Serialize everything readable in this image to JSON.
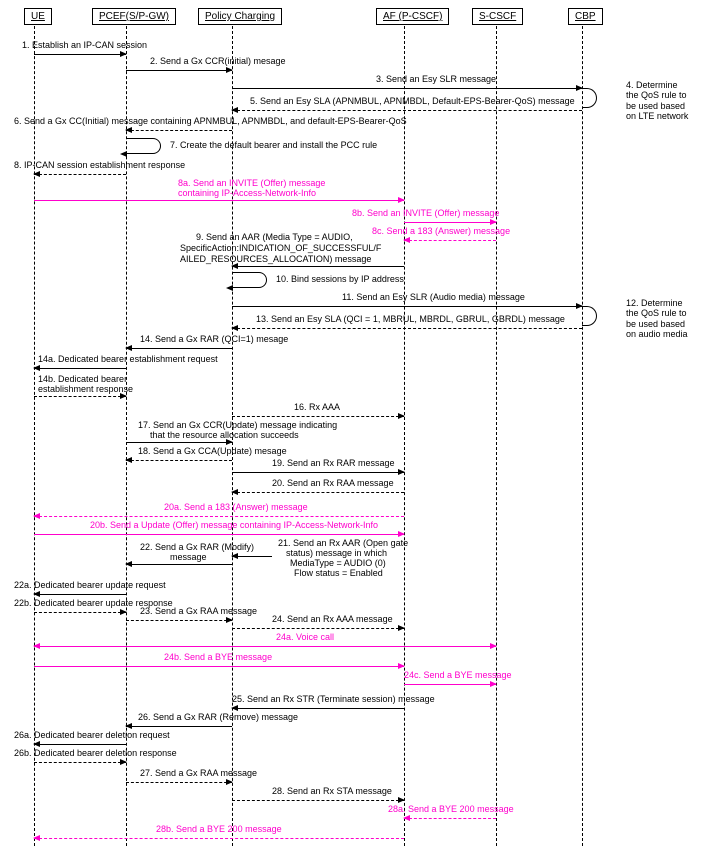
{
  "actors": {
    "ue": "UE",
    "pcef": "PCEF(S/P-GW)",
    "policy": "Policy Charging",
    "af": "AF (P-CSCF)",
    "scscf": "S-CSCF",
    "cbp": "CBP"
  },
  "messages": {
    "m1": "1. Establish an IP-CAN session",
    "m2": "2. Send a Gx CCR(initial) mesage",
    "m3": "3. Send an Esy SLR message",
    "m4": "4. Determine the QoS rule to be used based on LTE network",
    "m5": "5. Send an Esy SLA (APNMBUL, APNMBDL, Default-EPS-Bearer-QoS) message",
    "m6": "6. Send a Gx CC(Initial) message containing APNMBUL, APNMBDL, and default-EPS-Bearer-QoS",
    "m7": "7. Create the default bearer and install the PCC rule",
    "m8": "8. IP-CAN session establishment response",
    "m8a_l1": "8a. Send an INVITE (Offer) message",
    "m8a_l2": "containing IP-Access-Network-Info",
    "m8b": "8b. Send an INVITE (Offer) message",
    "m8c": "8c. Send a 183 (Answer) message",
    "m9_l1": "9. Send an AAR (Media Type = AUDIO,",
    "m9_l2": "SpecificAction:INDICATION_OF_SUCCESSFUL/F",
    "m9_l3": "AILED_RESOURCES_ALLOCATION) message",
    "m10": "10. Bind sessions by IP address",
    "m11": "11. Send an Esy SLR (Audio media) message",
    "m12": "12. Determine the QoS rule to be used based on audio media",
    "m13": "13. Send an Esy SLA (QCI = 1, MBRUL, MBRDL, GBRUL, GBRDL) message",
    "m14": "14. Send a Gx RAR (QCI=1) mesage",
    "m14a": "14a. Dedicated bearer establishment request",
    "m14b_l1": "14b. Dedicated bearer",
    "m14b_l2": "establishment response",
    "m16": "16. Rx AAA",
    "m17_l1": "17. Send an Gx CCR(Update) message indicating",
    "m17_l2": "that the resource allocation succeeds",
    "m18": "18. Send a Gx CCA(Update) mesage",
    "m19": "19. Send an Rx RAR message",
    "m20": "20. Send an Rx RAA message",
    "m20a": "20a. Send a 183 (Answer) message",
    "m20b": "20b. Send a Update (Offer) message containing IP-Access-Network-Info",
    "m21_l1": "21. Send an Rx AAR (Open gate",
    "m21_l2": "status) message in which",
    "m21_l3": "MediaType = AUDIO (0)",
    "m21_l4": "Flow status = Enabled",
    "m22_l1": "22. Send a Gx RAR (Modify)",
    "m22_l2": "message",
    "m22a": "22a. Dedicated bearer update request",
    "m22b": "22b. Dedicated bearer update response",
    "m23": "23. Send a Gx RAA message",
    "m24": "24. Send an Rx AAA message",
    "m24a": "24a. Voice call",
    "m24b": "24b. Send a BYE message",
    "m24c": "24c. Send a BYE message",
    "m25": "25. Send an Rx STR (Terminate session) message",
    "m26": "26. Send a Gx RAR (Remove) message",
    "m26a": "26a. Dedicated bearer deletion request",
    "m26b": "26b. Dedicated bearer deletion response",
    "m27": "27. Send a Gx RAA message",
    "m28": "28. Send an Rx STA message",
    "m28a": "28a. Send a BYE 200 message",
    "m28b": "28b. Send a BYE 200 message"
  }
}
